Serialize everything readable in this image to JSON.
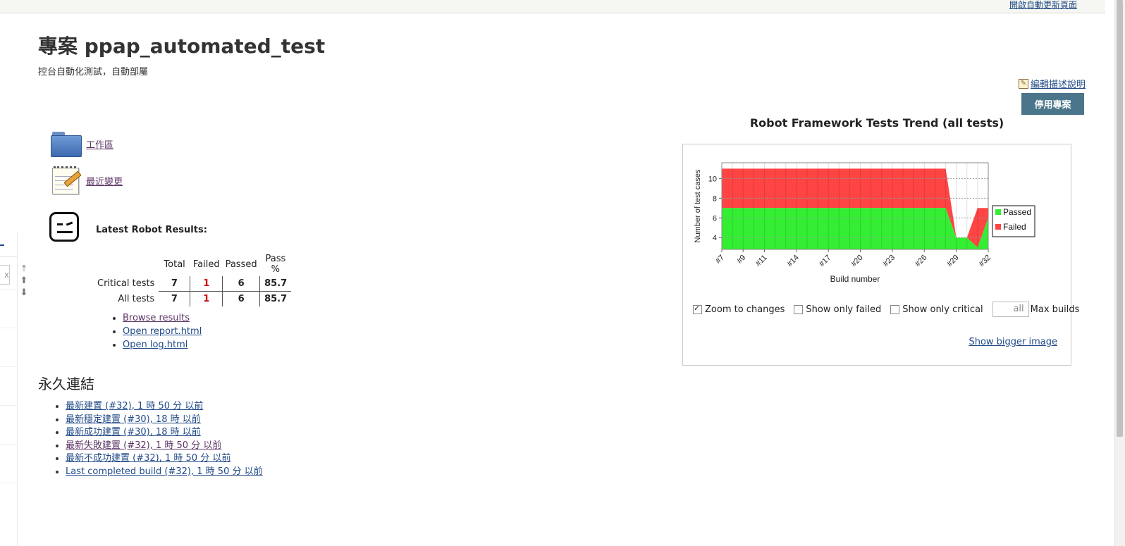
{
  "header": {
    "auto_refresh_label": "開啟自動更新頁面"
  },
  "project": {
    "title": "專案 ppap_automated_test",
    "description": "控台自動化測試，自動部屬",
    "edit_description_label": "編輯描述說明",
    "disable_button_label": "停用專案"
  },
  "tasks": [
    {
      "label": "工作區",
      "icon": "folder-icon"
    },
    {
      "label": "最近變更",
      "icon": "notepad-icon"
    }
  ],
  "side": {
    "search_clear": "x"
  },
  "robot": {
    "title": "Latest Robot Results:",
    "columns": [
      "Total",
      "Failed",
      "Passed",
      "Pass %"
    ],
    "rows": [
      {
        "label": "Critical tests",
        "total": "7",
        "failed": "1",
        "passed": "6",
        "pass_pct": "85.7"
      },
      {
        "label": "All tests",
        "total": "7",
        "failed": "1",
        "passed": "6",
        "pass_pct": "85.7"
      }
    ],
    "links": [
      "Browse results",
      "Open report.html",
      "Open log.html"
    ]
  },
  "permalinks": {
    "heading": "永久連結",
    "items": [
      "最新建置 (#32), 1 時 50 分 以前",
      "最新穩定建置 (#30), 18 時 以前",
      "最新成功建置 (#30), 18 時 以前",
      "最新失敗建置 (#32), 1 時 50 分 以前",
      "最新不成功建置 (#32), 1 時 50 分 以前",
      "Last completed build (#32), 1 時 50 分 以前"
    ]
  },
  "trend": {
    "title": "Robot Framework Tests Trend (all tests)",
    "zoom_label": "Zoom to changes",
    "only_failed_label": "Show only failed",
    "only_critical_label": "Show only critical",
    "max_builds_value": "all",
    "max_builds_label": "Max builds",
    "bigger_image_label": "Show bigger image"
  },
  "chart_data": {
    "type": "area",
    "title": "",
    "xlabel": "Build number",
    "ylabel": "Number of test cases",
    "x": [
      "#7",
      "#8",
      "#9",
      "#10",
      "#11",
      "#12",
      "#13",
      "#14",
      "#15",
      "#16",
      "#17",
      "#18",
      "#19",
      "#20",
      "#21",
      "#22",
      "#23",
      "#24",
      "#25",
      "#26",
      "#27",
      "#28",
      "#29",
      "#30",
      "#31",
      "#32"
    ],
    "x_tick_labels": [
      "#7",
      "#9",
      "#11",
      "#14",
      "#17",
      "#20",
      "#23",
      "#26",
      "#29",
      "#32"
    ],
    "series": [
      {
        "name": "Passed",
        "color": "#33ee33",
        "values": [
          7,
          7,
          7,
          7,
          7,
          7,
          7,
          7,
          7,
          7,
          7,
          7,
          7,
          7,
          7,
          7,
          7,
          7,
          7,
          7,
          7,
          7,
          4,
          4,
          3,
          6
        ]
      },
      {
        "name": "Failed",
        "color": "#ff4444",
        "values": [
          4,
          4,
          4,
          4,
          4,
          4,
          4,
          4,
          4,
          4,
          4,
          4,
          4,
          4,
          4,
          4,
          4,
          4,
          4,
          4,
          4,
          4,
          0,
          0,
          4,
          1
        ]
      }
    ],
    "stacked": true,
    "ylim": [
      2.8,
      11.6
    ],
    "yticks": [
      4,
      6,
      8,
      10
    ],
    "grid": true,
    "legend_position": "right"
  }
}
